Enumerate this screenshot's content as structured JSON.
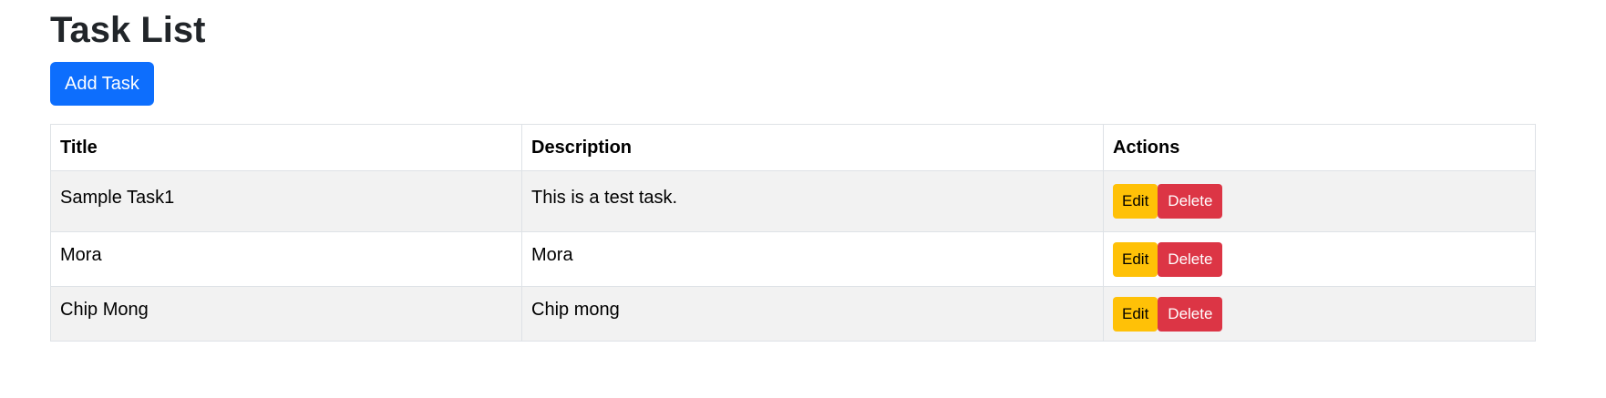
{
  "page": {
    "title": "Task List",
    "add_button_label": "Add Task"
  },
  "table": {
    "headers": {
      "title": "Title",
      "description": "Description",
      "actions": "Actions"
    },
    "rows": [
      {
        "title": "Sample Task1",
        "description": "This is a test task.",
        "edit_label": "Edit",
        "delete_label": "Delete"
      },
      {
        "title": "Mora",
        "description": "Mora",
        "edit_label": "Edit",
        "delete_label": "Delete"
      },
      {
        "title": "Chip Mong",
        "description": "Chip mong",
        "edit_label": "Edit",
        "delete_label": "Delete"
      }
    ]
  },
  "colors": {
    "primary": "#0d6efd",
    "warning": "#ffc107",
    "danger": "#dc3545",
    "row_stripe": "#f2f2f2",
    "border": "#dee2e6"
  }
}
